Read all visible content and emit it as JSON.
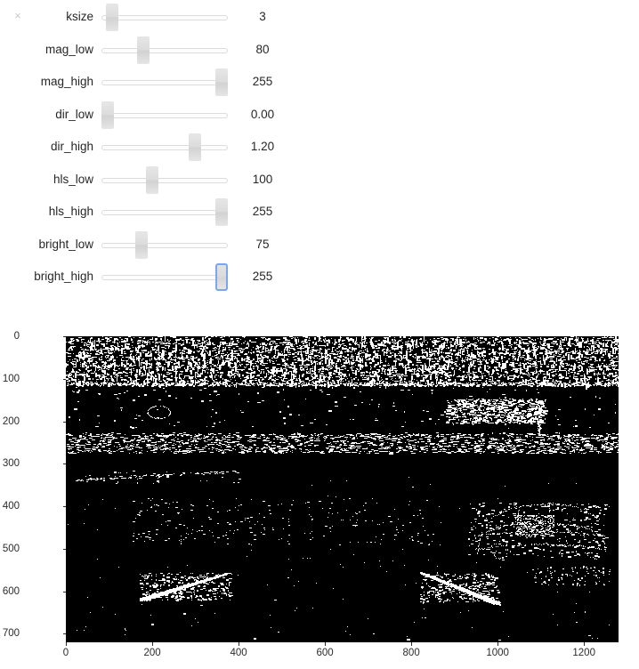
{
  "window": {
    "close_label": "×",
    "close_icon": "close-icon"
  },
  "controls": {
    "sliders": [
      {
        "name": "ksize",
        "label": "ksize",
        "value": "3",
        "fraction": 0.038,
        "focused": false
      },
      {
        "name": "mag_low",
        "label": "mag_low",
        "value": "80",
        "fraction": 0.314,
        "focused": false
      },
      {
        "name": "mag_high",
        "label": "mag_high",
        "value": "255",
        "fraction": 1.0,
        "focused": false
      },
      {
        "name": "dir_low",
        "label": "dir_low",
        "value": "0.00",
        "fraction": 0.0,
        "focused": false
      },
      {
        "name": "dir_high",
        "label": "dir_high",
        "value": "1.20",
        "fraction": 0.764,
        "focused": false
      },
      {
        "name": "hls_low",
        "label": "hls_low",
        "value": "100",
        "fraction": 0.392,
        "focused": false
      },
      {
        "name": "hls_high",
        "label": "hls_high",
        "value": "255",
        "fraction": 1.0,
        "focused": false
      },
      {
        "name": "bright_low",
        "label": "bright_low",
        "value": "75",
        "fraction": 0.294,
        "focused": false
      },
      {
        "name": "bright_high",
        "label": "bright_high",
        "value": "255",
        "fraction": 1.0,
        "focused": true
      }
    ]
  },
  "chart_data": {
    "type": "heatmap",
    "title": "",
    "xlabel": "",
    "ylabel": "",
    "colormap": "gray",
    "grid": false,
    "legend": null,
    "xlim": [
      0,
      1280
    ],
    "ylim": [
      720,
      0
    ],
    "xticks": [
      0,
      200,
      400,
      600,
      800,
      1000,
      1200
    ],
    "yticks": [
      0,
      100,
      200,
      300,
      400,
      500,
      600,
      700
    ],
    "xtick_labels": [
      "0",
      "200",
      "400",
      "600",
      "800",
      "1000",
      "1200"
    ],
    "ytick_labels": [
      "0",
      "100",
      "200",
      "300",
      "400",
      "500",
      "600",
      "700"
    ],
    "value_range": [
      0,
      1
    ],
    "description": "Binary thresholded road-scene mask: white pixels = 1, black = 0",
    "regions": [
      {
        "name": "sky-tree-clutter",
        "y_range": [
          0,
          115
        ],
        "x_range": [
          0,
          1280
        ],
        "density": 0.34
      },
      {
        "name": "horizon-band",
        "y_range": [
          115,
          215
        ],
        "x_range": [
          0,
          1280
        ],
        "density": 0.02
      },
      {
        "name": "overpass-signs",
        "y_range": [
          145,
          205
        ],
        "x_range": [
          880,
          1110
        ],
        "density": 0.22
      },
      {
        "name": "guardrail-row",
        "y_range": [
          225,
          275
        ],
        "x_range": [
          0,
          1280
        ],
        "density": 0.07
      },
      {
        "name": "road-shoulder",
        "y_range": [
          315,
          345
        ],
        "x_range": [
          0,
          400
        ],
        "density": 0.04
      },
      {
        "name": "car-right",
        "y_range": [
          390,
          520
        ],
        "x_range": [
          930,
          1250
        ],
        "density": 0.1
      },
      {
        "name": "lane-line-left",
        "y_range": [
          555,
          620
        ],
        "x_range": [
          170,
          380
        ],
        "density": 0.3
      },
      {
        "name": "lane-line-right",
        "y_range": [
          555,
          625
        ],
        "x_range": [
          820,
          1000
        ],
        "density": 0.3
      },
      {
        "name": "road-dark",
        "y_range": [
          620,
          720
        ],
        "x_range": [
          0,
          1280
        ],
        "density": 0.002
      }
    ]
  },
  "colors": {
    "handle": "#dcdcdc",
    "track_border": "#dcdcdc",
    "focus_ring": "#7aa7e9",
    "text": "#262626",
    "close": "#c9c9c9",
    "plot_bg": "#000000",
    "plot_fg": "#ffffff"
  }
}
